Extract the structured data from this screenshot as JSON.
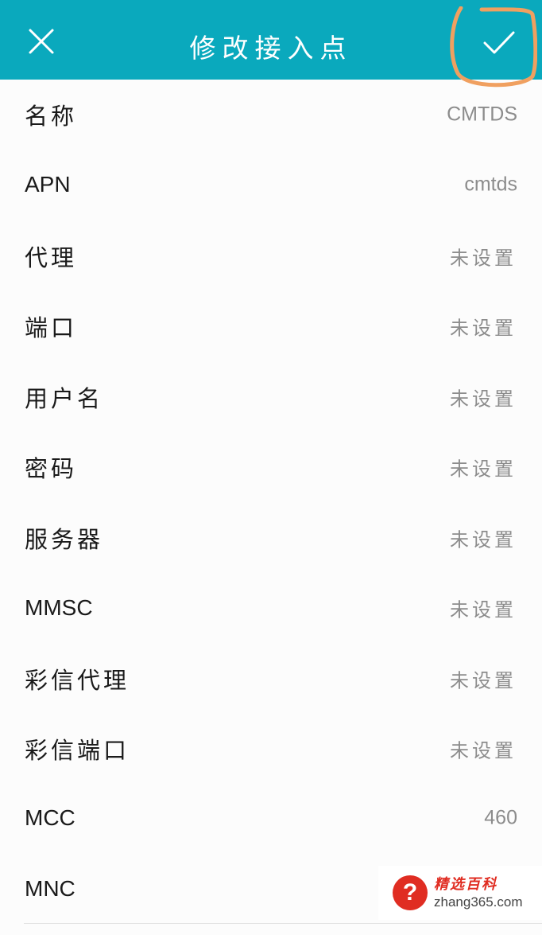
{
  "header": {
    "title": "修改接入点",
    "close_icon": "close-icon",
    "confirm_icon": "check-icon",
    "background_color": "#0aa9bd",
    "highlight_color": "#f0a060"
  },
  "fields": [
    {
      "label": "名称",
      "value": "CMTDS"
    },
    {
      "label": "APN",
      "value": "cmtds"
    },
    {
      "label": "代理",
      "value": "未设置"
    },
    {
      "label": "端口",
      "value": "未设置"
    },
    {
      "label": "用户名",
      "value": "未设置"
    },
    {
      "label": "密码",
      "value": "未设置"
    },
    {
      "label": "服务器",
      "value": "未设置"
    },
    {
      "label": "MMSC",
      "value": "未设置"
    },
    {
      "label": "彩信代理",
      "value": "未设置"
    },
    {
      "label": "彩信端口",
      "value": "未设置"
    },
    {
      "label": "MCC",
      "value": "460"
    },
    {
      "label": "MNC",
      "value": ""
    }
  ],
  "watermark": {
    "title": "精选百科",
    "url": "zhang365.com",
    "icon": "question-mark-icon",
    "color": "#e02d22"
  }
}
